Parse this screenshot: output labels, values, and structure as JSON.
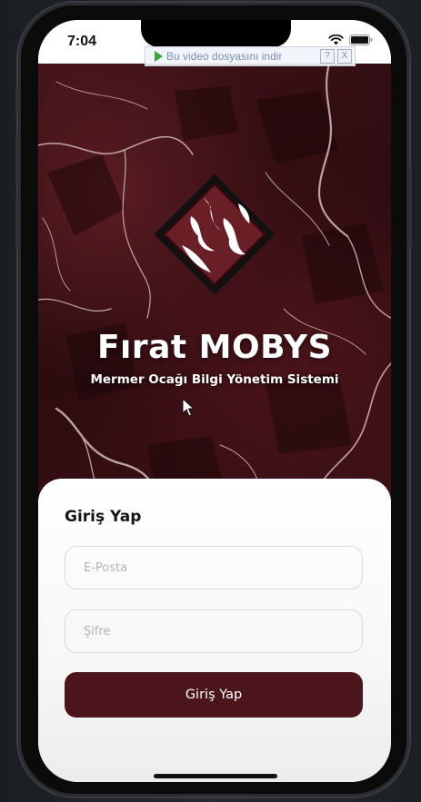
{
  "status_bar": {
    "time": "7:04"
  },
  "video_banner": {
    "text": "Bu video dosyasını indir",
    "help_label": "?",
    "close_label": "X"
  },
  "hero": {
    "title": "Fırat MOBYS",
    "subtitle": "Mermer Ocağı Bilgi Yönetim Sistemi"
  },
  "login": {
    "title": "Giriş Yap",
    "email_placeholder": "E-Posta",
    "password_placeholder": "Şifre",
    "submit_label": "Giriş Yap"
  },
  "colors": {
    "brand": "#4b151b",
    "marble_dark": "#2a0b0e"
  }
}
